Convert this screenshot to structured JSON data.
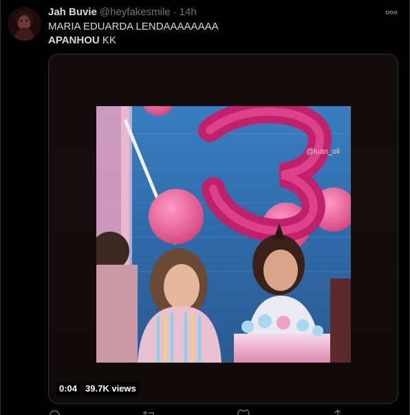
{
  "tweet": {
    "author": {
      "display_name": "Jah Buvie",
      "handle": "@heyfakesmile"
    },
    "separator": "·",
    "timestamp": "14h",
    "text_line1": "MARIA EDUARDA LENDAAAAAAAA",
    "text_line2_bold": "APANHOU",
    "text_line2_rest": " KK",
    "media": {
      "watermark": "@luan_oli",
      "elapsed": "0:04",
      "views": "39.7K views"
    }
  },
  "icons": {
    "more": "more-horizontal-icon",
    "reply": "reply-icon",
    "retweet": "retweet-icon",
    "like": "like-icon",
    "share": "share-icon"
  },
  "colors": {
    "background": "#000000",
    "text": "#d9d9d9",
    "secondary": "#6e767d",
    "border": "#2f3336"
  }
}
